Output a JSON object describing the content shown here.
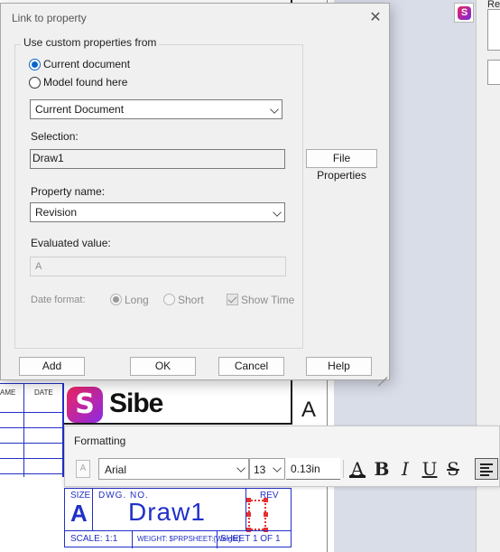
{
  "dialog": {
    "title": "Link to property",
    "close_icon": "close-icon",
    "group_title": "Use custom properties from",
    "radio_current": "Current document",
    "radio_model": "Model found here",
    "source_combo": "Current Document",
    "selection_label": "Selection:",
    "selection_value": "Draw1",
    "file_properties_button": "File Properties",
    "property_name_label": "Property name:",
    "property_name_value": "Revision",
    "evaluated_label": "Evaluated value:",
    "evaluated_value": "A",
    "date_format_label": "Date format:",
    "date_long": "Long",
    "date_short": "Short",
    "show_time": "Show Time",
    "buttons": {
      "add": "Add",
      "ok": "OK",
      "cancel": "Cancel",
      "help": "Help"
    }
  },
  "formatting": {
    "title": "Formatting",
    "font": "Arial",
    "size": "13",
    "height": "0.13in",
    "color_glyph": "A",
    "bold_glyph": "B",
    "italic_glyph": "I",
    "underline_glyph": "U",
    "strike_glyph": "S"
  },
  "sheet": {
    "rev_col_name": "AME",
    "rev_col_date": "DATE",
    "logo_text": "Sibe",
    "logo_glyph": "S",
    "rev_letter": "A",
    "size_label": "SIZE",
    "size_value": "A",
    "dwg_label": "DWG.  NO.",
    "dwg_value": "Draw1",
    "rev_label": "REV",
    "scale": "SCALE: 1:1",
    "weight": "WEIGHT: $PRPSHEET:{Weight}",
    "sheet": "SHEET 1 OF 1"
  },
  "right_panel": {
    "label": "Re"
  },
  "colors": {
    "accent": "#0a64c8",
    "drawing_blue": "#2230c8",
    "selection_red": "#e53030"
  }
}
